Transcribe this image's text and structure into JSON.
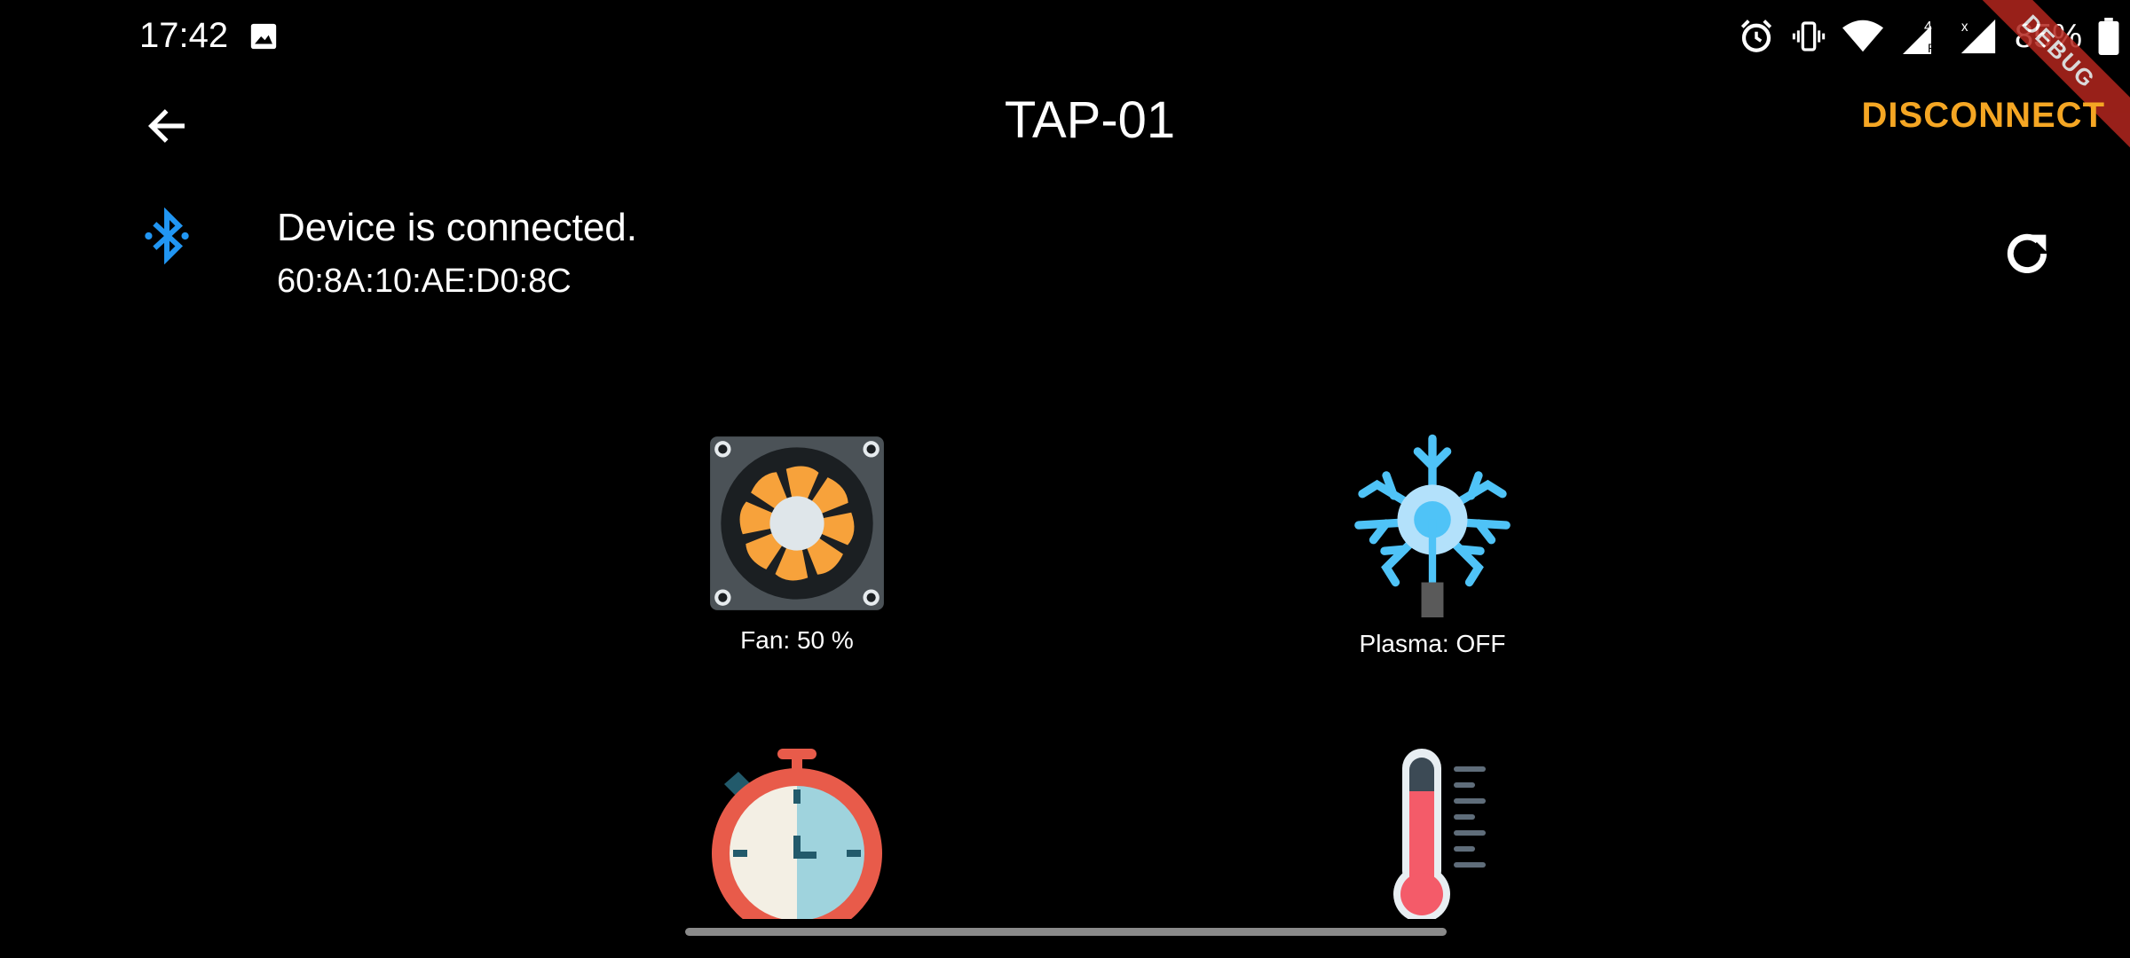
{
  "status_bar": {
    "time": "17:42",
    "battery_percent": "85%",
    "icons": [
      "image-icon",
      "alarm-icon",
      "vibrate-icon",
      "wifi-icon",
      "cell-signal-roaming-icon",
      "cell-signal-icon",
      "battery-icon"
    ]
  },
  "debug_banner": "DEBUG",
  "app_bar": {
    "back_icon": "arrow-back-icon",
    "title": "TAP-01",
    "disconnect_label": "DISCONNECT"
  },
  "device": {
    "icon": "bluetooth-connected-icon",
    "status": "Device is connected.",
    "mac": "60:8A:10:AE:D0:8C",
    "refresh_icon": "refresh-icon"
  },
  "tiles": [
    {
      "icon": "fan-icon",
      "label": "Fan: 50 %"
    },
    {
      "icon": "plasma-icon",
      "label": "Plasma: OFF"
    },
    {
      "icon": "stopwatch-icon",
      "label": ""
    },
    {
      "icon": "thermometer-icon",
      "label": ""
    }
  ],
  "colors": {
    "background": "#000000",
    "accent": "#f5a623",
    "bluetooth": "#2196f3"
  }
}
